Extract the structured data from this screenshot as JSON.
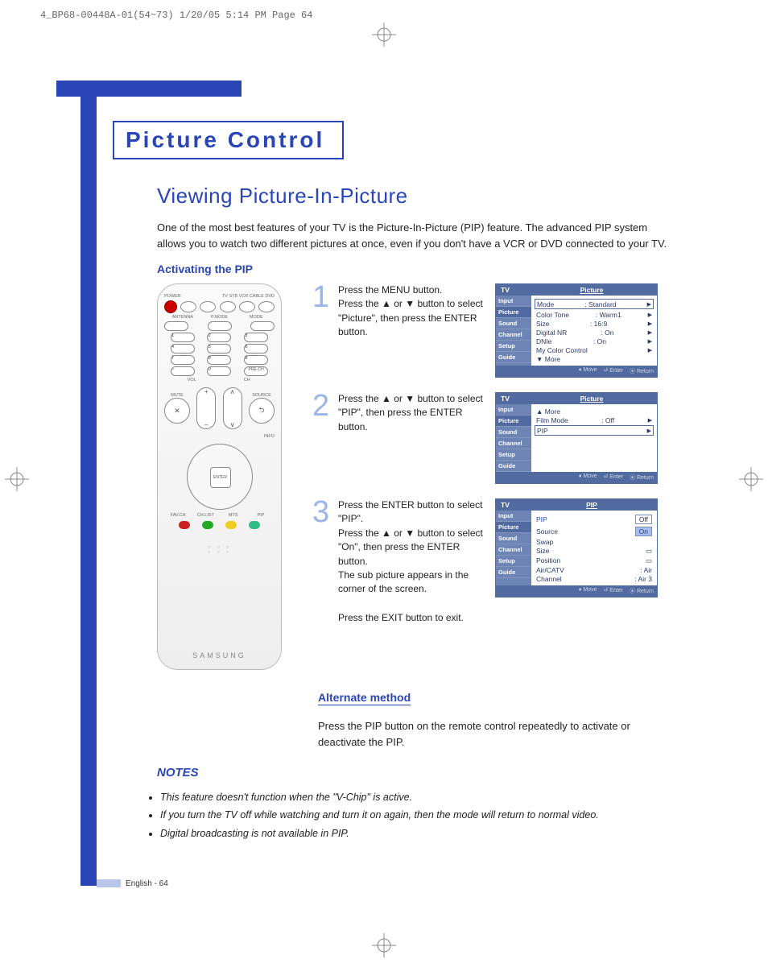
{
  "printer_mark": "4_BP68-00448A-01(54~73)  1/20/05  5:14 PM  Page 64",
  "chapter": "Picture Control",
  "section_title": "Viewing Picture-In-Picture",
  "intro": "One of the most best features of your TV is the Picture-In-Picture (PIP) feature. The advanced PIP system allows you to watch two different pictures at once, even if you don't have a VCR or DVD connected to your TV.",
  "sub_activating": "Activating the PIP",
  "remote": {
    "power": "POWER",
    "top_labels": "TV  STB  VCR  CABLE  DVD",
    "row2_labels": [
      "ANTENNA",
      "P.MODE",
      "MODE"
    ],
    "vol": "VOL",
    "ch": "CH",
    "mute": "MUTE",
    "source": "SOURCE",
    "info": "INFO",
    "enter": "ENTER",
    "bottom_labels": [
      "FAV.CH",
      "CH.LIST",
      "MTS",
      "PIP"
    ],
    "brand": "SAMSUNG",
    "prech": "PRE-CH"
  },
  "steps": [
    {
      "n": "1",
      "text": "Press the MENU button.\nPress the ▲ or ▼ button to select \"Picture\", then press the ENTER button."
    },
    {
      "n": "2",
      "text": "Press the ▲ or ▼ button to select \"PIP\", then press the ENTER button."
    },
    {
      "n": "3",
      "text": "Press the ENTER button to select \"PIP\".\nPress the ▲ or ▼ button to select \"On\", then press the ENTER button.\nThe sub picture appears in the corner of the screen."
    }
  ],
  "exit_line": "Press the EXIT button to exit.",
  "osd": {
    "tv": "TV",
    "left_menu": [
      "Input",
      "Picture",
      "Sound",
      "Channel",
      "Setup",
      "Guide"
    ],
    "foot": [
      "Move",
      "Enter",
      "Return"
    ],
    "picture1": {
      "title": "Picture",
      "rows": [
        [
          "Mode",
          ": Standard"
        ],
        [
          "Color Tone",
          ": Warm1"
        ],
        [
          "Size",
          ": 16:9"
        ],
        [
          "Digital NR",
          ": On"
        ],
        [
          "DNIe",
          ": On"
        ],
        [
          "My Color Control",
          ""
        ],
        [
          "▼ More",
          ""
        ]
      ]
    },
    "picture2": {
      "title": "Picture",
      "rows": [
        [
          "▲ More",
          ""
        ],
        [
          "Film Mode",
          ": Off"
        ],
        [
          "PIP",
          ""
        ]
      ]
    },
    "pip": {
      "title": "PIP",
      "rows": [
        [
          "PIP",
          ""
        ],
        [
          "Source",
          ""
        ],
        [
          "Swap",
          ""
        ],
        [
          "Size",
          ""
        ],
        [
          "Position",
          ""
        ],
        [
          "Air/CATV",
          ": Air"
        ],
        [
          "Channel",
          ": Air 3"
        ]
      ],
      "opt_off": "Off",
      "opt_on": "On"
    }
  },
  "alt_head": "Alternate method",
  "alt_text": "Press the PIP button on the remote control repeatedly to activate or deactivate the PIP.",
  "notes_head": "NOTES",
  "notes": [
    "This feature doesn't function when the \"V-Chip\" is active.",
    "If you turn the TV off while watching and turn it on again, then the mode will return to normal video.",
    "Digital broadcasting is not available in PIP."
  ],
  "footer": "English - 64"
}
